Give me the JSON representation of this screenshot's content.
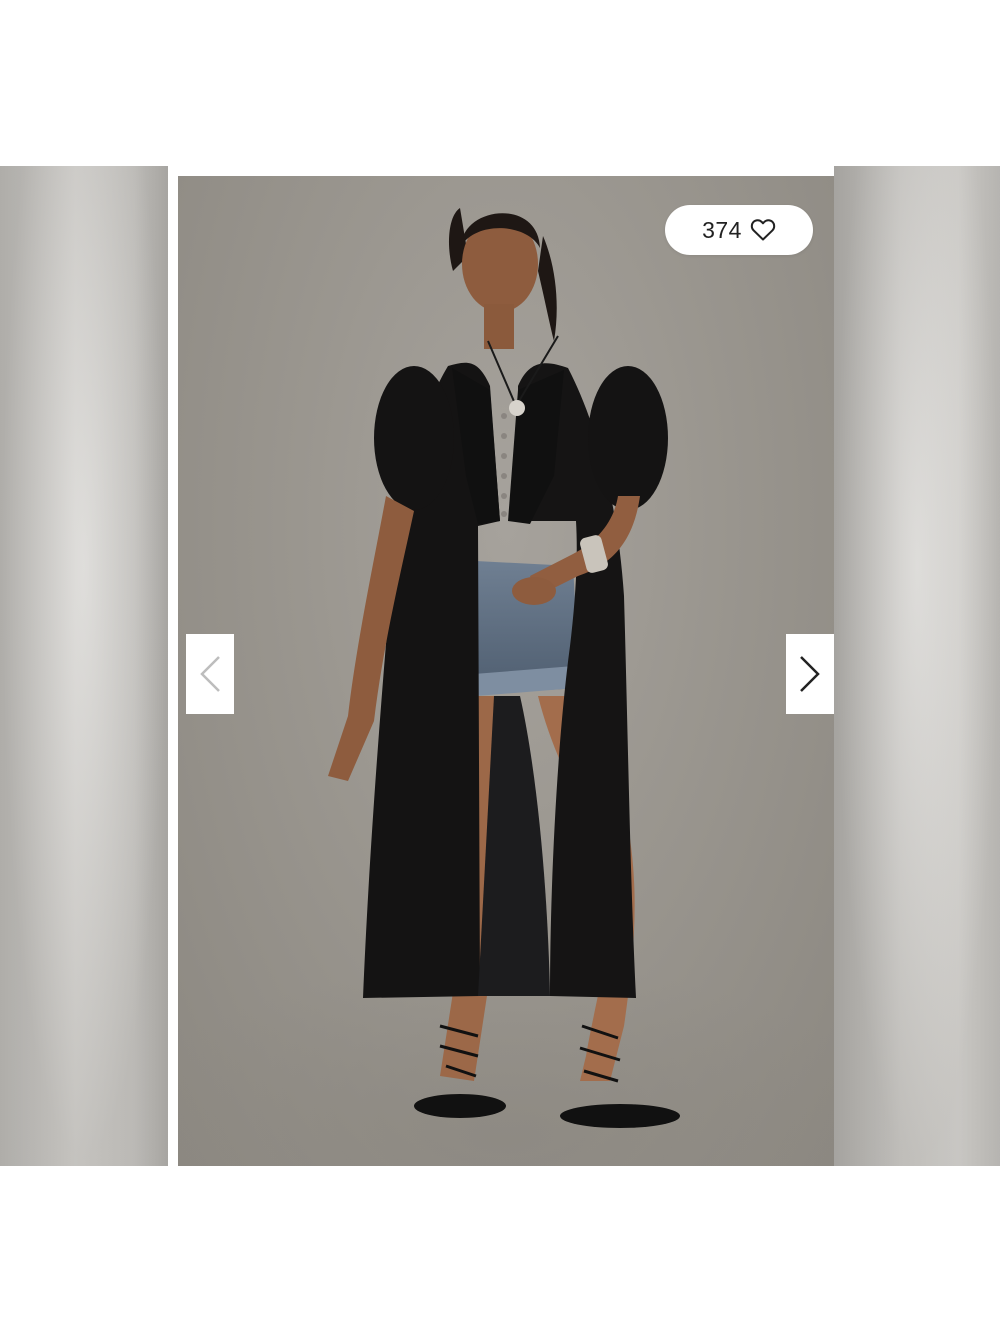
{
  "gallery": {
    "like_count": "374",
    "icons": {
      "like": "heart-outline-icon",
      "prev": "chevron-left-icon",
      "next": "chevron-right-icon"
    },
    "colors": {
      "prev_arrow": "#bdbdbd",
      "next_arrow": "#222222",
      "backdrop": "#9a968f"
    }
  }
}
